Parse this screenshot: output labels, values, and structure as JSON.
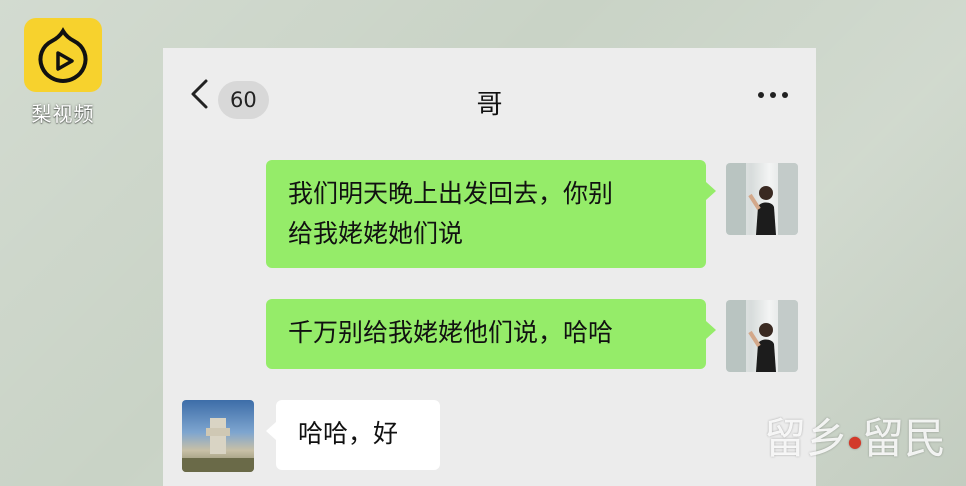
{
  "watermark": {
    "logo_text": "梨视频",
    "corner_text_1": "留",
    "corner_text_2": "乡",
    "corner_text_3": "留民"
  },
  "header": {
    "back_icon": "chevron-left-icon",
    "unread_count": "60",
    "title": "哥",
    "more_icon": "more-dots-icon"
  },
  "messages": [
    {
      "side": "right",
      "text_line1": "我们明天晚上出发回去，你别",
      "text_line2": "给我姥姥她们说"
    },
    {
      "side": "right",
      "text": "千万别给我姥姥他们说，哈哈"
    },
    {
      "side": "left",
      "text": "哈哈，好"
    }
  ],
  "colors": {
    "sent_bubble": "#95ec69",
    "received_bubble": "#ffffff",
    "chat_bg": "#ececec"
  }
}
